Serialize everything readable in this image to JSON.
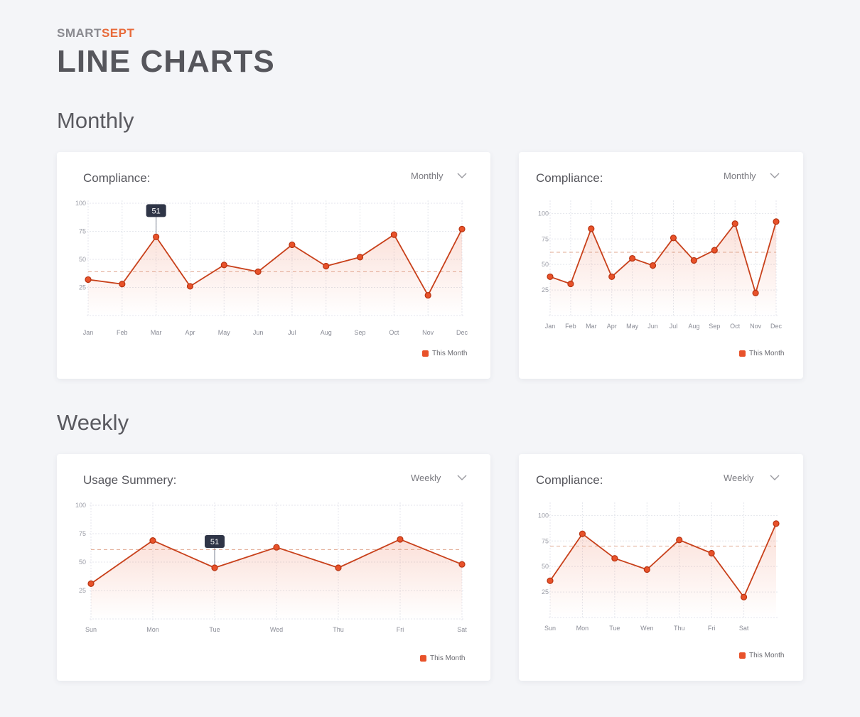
{
  "header": {
    "brand_a": "SMART",
    "brand_b": "SEPT",
    "title": "LINE CHARTS"
  },
  "sections": {
    "monthly": "Monthly",
    "weekly": "Weekly"
  },
  "colors": {
    "accent": "#e8522a",
    "line": "#c8401a",
    "tooltip_bg": "#2f3547",
    "background": "#f4f5f8"
  },
  "cards": [
    {
      "title": "Compliance:",
      "period": "Monthly",
      "legend": "This Month",
      "tooltip": "51"
    },
    {
      "title": "Compliance:",
      "period": "Monthly",
      "legend": "This Month"
    },
    {
      "title": "Usage Summery:",
      "period": "Weekly",
      "legend": "This Month",
      "tooltip": "51"
    },
    {
      "title": "Compliance:",
      "period": "Weekly",
      "legend": "This Month"
    }
  ],
  "chart_data": [
    {
      "type": "line",
      "categories": [
        "Jan",
        "Feb",
        "Mar",
        "Apr",
        "May",
        "Jun",
        "Jul",
        "Aug",
        "Sep",
        "Oct",
        "Nov",
        "Dec"
      ],
      "yticks": [
        "100",
        "75",
        "50",
        "25"
      ],
      "ylim": [
        0,
        100
      ],
      "series": [
        {
          "name": "This Month",
          "values": [
            32,
            28,
            70,
            26,
            45,
            39,
            63,
            44,
            52,
            72,
            18,
            77
          ]
        }
      ],
      "reference": 39,
      "tooltip_index": 2,
      "grid": true,
      "legend_position": "bottom-right"
    },
    {
      "type": "line",
      "categories": [
        "Jan",
        "Feb",
        "Mar",
        "Apr",
        "May",
        "Jun",
        "Jul",
        "Aug",
        "Sep",
        "Oct",
        "Nov",
        "Dec"
      ],
      "yticks": [
        "100",
        "75",
        "50",
        "25"
      ],
      "ylim": [
        0,
        110
      ],
      "series": [
        {
          "name": "This Month",
          "values": [
            38,
            31,
            85,
            38,
            56,
            49,
            76,
            54,
            64,
            90,
            22,
            92
          ]
        }
      ],
      "reference": 62,
      "grid": true,
      "legend_position": "bottom-right"
    },
    {
      "type": "line",
      "categories": [
        "Sun",
        "Mon",
        "Tue",
        "Wed",
        "Thu",
        "Fri",
        "Sat"
      ],
      "yticks": [
        "100",
        "75",
        "50",
        "25"
      ],
      "ylim": [
        0,
        100
      ],
      "series": [
        {
          "name": "This Month",
          "values": [
            31,
            69,
            45,
            63,
            45,
            70,
            48
          ]
        }
      ],
      "reference": 61,
      "tooltip_index": 2,
      "grid": true,
      "legend_position": "bottom-right"
    },
    {
      "type": "line",
      "categories": [
        "Sun",
        "Mon",
        "Tue",
        "Wen",
        "Thu",
        "Fri",
        "Sat"
      ],
      "yticks": [
        "100",
        "75",
        "50",
        "25"
      ],
      "ylim": [
        0,
        110
      ],
      "series": [
        {
          "name": "This Month",
          "values": [
            36,
            82,
            58,
            47,
            76,
            63,
            20,
            92
          ]
        }
      ],
      "reference": 70,
      "grid": true,
      "legend_position": "bottom-right"
    }
  ]
}
